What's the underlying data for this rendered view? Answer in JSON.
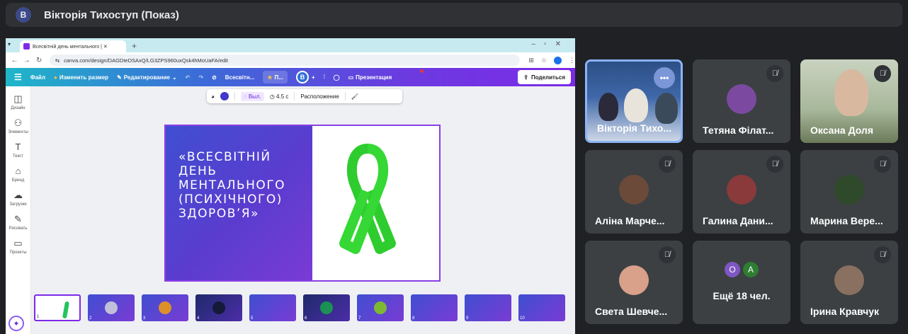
{
  "presenter": {
    "avatar_letter": "В",
    "title": "Вікторія Тихоступ (Показ)"
  },
  "browser": {
    "tab_title": "Всесвітній день ментального | ✕",
    "url": "canva.com/design/DAGDteDSAxQ/LG3ZPS960uxQsk4hMoUaFA/edit"
  },
  "canva": {
    "menu": "Файл",
    "resize": "Изменить размер",
    "edit": "Редактирование",
    "doc_name": "Всесвітн...",
    "brand_chip": "П...",
    "user_letter": "B",
    "present": "Презентация",
    "share": "Поделиться",
    "toolbar": {
      "select": "Выл.",
      "duration": "4.5 с",
      "position": "Расположение"
    },
    "sidebar": [
      {
        "label": "Дизайн",
        "icon": "design-icon",
        "glyph": "◫"
      },
      {
        "label": "Элементы",
        "icon": "elements-icon",
        "glyph": "⚇"
      },
      {
        "label": "Текст",
        "icon": "text-icon",
        "glyph": "T"
      },
      {
        "label": "Бренд",
        "icon": "brand-icon",
        "glyph": "⌂"
      },
      {
        "label": "Загрузки",
        "icon": "uploads-icon",
        "glyph": "☁"
      },
      {
        "label": "Рисовать",
        "icon": "draw-icon",
        "glyph": "✎"
      },
      {
        "label": "Проекты",
        "icon": "projects-icon",
        "glyph": "▭"
      }
    ],
    "slide_title": "«ВСЕСВІТНІЙ\nДЕНЬ\nМЕНТАЛЬНОГО\n(ПСИХІЧНОГО)\nЗДОРОВ’Я»",
    "ribbon_color": "#2ecc2e",
    "thumbnails": [
      "1",
      "2",
      "3",
      "4",
      "5",
      "6",
      "7",
      "8",
      "9",
      "10"
    ]
  },
  "participants": [
    {
      "name": "Вікторія Тихо...",
      "video": true,
      "speaking": true
    },
    {
      "name": "Тетяна Філат...",
      "muted": true,
      "avatar_color": "#7b4aa0"
    },
    {
      "name": "Оксана Доля",
      "muted": true,
      "video": true
    },
    {
      "name": "Аліна Марче...",
      "muted": true,
      "avatar_color": "#6b4a3a"
    },
    {
      "name": "Галина Дани...",
      "muted": true,
      "avatar_color": "#8a3a3a"
    },
    {
      "name": "Марина Вере...",
      "muted": true,
      "avatar_color": "#2f4a2a"
    },
    {
      "name": "Света Шевче...",
      "muted": true,
      "avatar_color": "#d9a08a"
    },
    {
      "name": "Ещё 18 чел.",
      "avatars": [
        "O",
        "A"
      ],
      "avatar_colors": [
        "#7e57c2",
        "#2e7d32"
      ]
    },
    {
      "name": "Ірина Кравчук",
      "muted": true,
      "avatar_color": "#8a7060"
    }
  ],
  "colors": {
    "accent": "#8ab4f8",
    "canva_purple": "#7d2ae8"
  }
}
